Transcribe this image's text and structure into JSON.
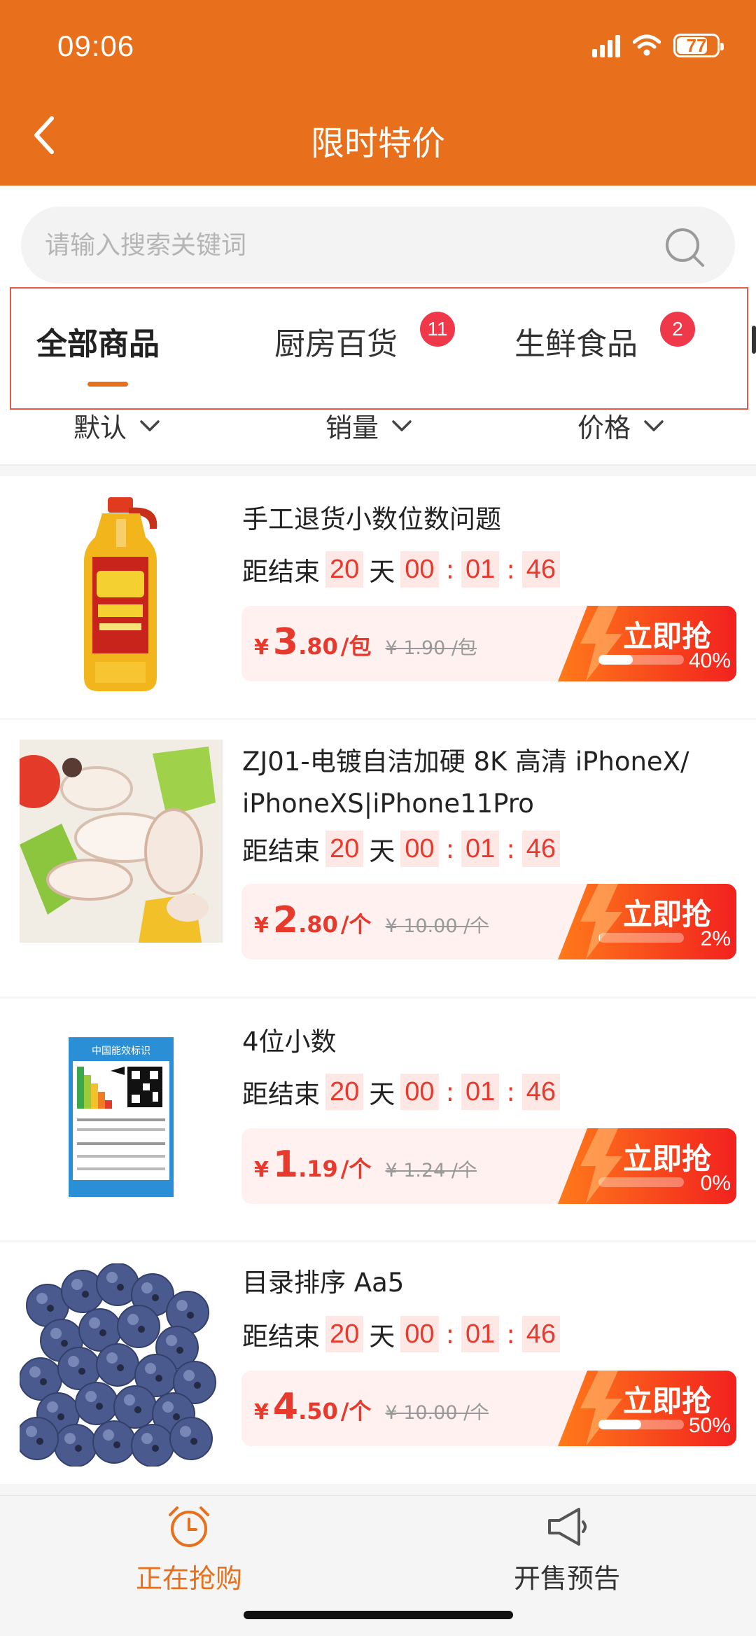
{
  "status_bar": {
    "time": "09:06",
    "battery": "77",
    "battery_level": 0.77
  },
  "header": {
    "title": "限时特价",
    "back_icon": "chevron-left-icon"
  },
  "search": {
    "placeholder": "请输入搜索关键词",
    "icon": "search-icon"
  },
  "tabs": [
    {
      "label": "全部商品",
      "active": true,
      "badge": ""
    },
    {
      "label": "厨房百货",
      "active": false,
      "badge": "11"
    },
    {
      "label": "生鲜食品",
      "active": false,
      "badge": "2"
    }
  ],
  "sort": [
    {
      "label": "默认"
    },
    {
      "label": "销量"
    },
    {
      "label": "价格"
    }
  ],
  "countdown_label": "距结束",
  "grab_label": "立即抢",
  "products": [
    {
      "title": "手工退货小数位数问题",
      "countdown": {
        "days": "20",
        "day_unit": "天",
        "hh": "00",
        "mm": "01",
        "ss": "46"
      },
      "price": {
        "currency": "¥",
        "int": "3",
        "dec": ".80",
        "unit": "/包"
      },
      "orig": "¥ 1.90 /包",
      "progress_pct": "40%",
      "progress": 0.4,
      "image": "cooking-oil-bottle"
    },
    {
      "title": "ZJ01-电镀自洁加硬 8K 高清 iPhoneX/ iPhoneXS|iPhone11Pro",
      "countdown": {
        "days": "20",
        "day_unit": "天",
        "hh": "00",
        "mm": "01",
        "ss": "46"
      },
      "price": {
        "currency": "¥",
        "int": "2",
        "dec": ".80",
        "unit": "/个"
      },
      "orig": "¥ 10.00 /个",
      "progress_pct": "2%",
      "progress": 0.02,
      "image": "stir-fried-seafood"
    },
    {
      "title": "4位小数",
      "countdown": {
        "days": "20",
        "day_unit": "天",
        "hh": "00",
        "mm": "01",
        "ss": "46"
      },
      "price": {
        "currency": "¥",
        "int": "1",
        "dec": ".19",
        "unit": "/个"
      },
      "orig": "¥ 1.24 /个",
      "progress_pct": "0%",
      "progress": 0.0,
      "image": "energy-label",
      "image_text": {
        "heading": "中国能效标识"
      }
    },
    {
      "title": "目录排序 Aa5",
      "countdown": {
        "days": "20",
        "day_unit": "天",
        "hh": "00",
        "mm": "01",
        "ss": "46"
      },
      "price": {
        "currency": "¥",
        "int": "4",
        "dec": ".50",
        "unit": "/个"
      },
      "orig": "¥ 10.00 /个",
      "progress_pct": "50%",
      "progress": 0.5,
      "image": "blueberries"
    }
  ],
  "bottom_nav": [
    {
      "label": "正在抢购",
      "icon": "alarm-clock-icon",
      "active": true
    },
    {
      "label": "开售预告",
      "icon": "megaphone-icon",
      "active": false
    }
  ],
  "colors": {
    "brand": "#e86f1b",
    "accent_red": "#e8392d",
    "badge": "#f0384b"
  }
}
